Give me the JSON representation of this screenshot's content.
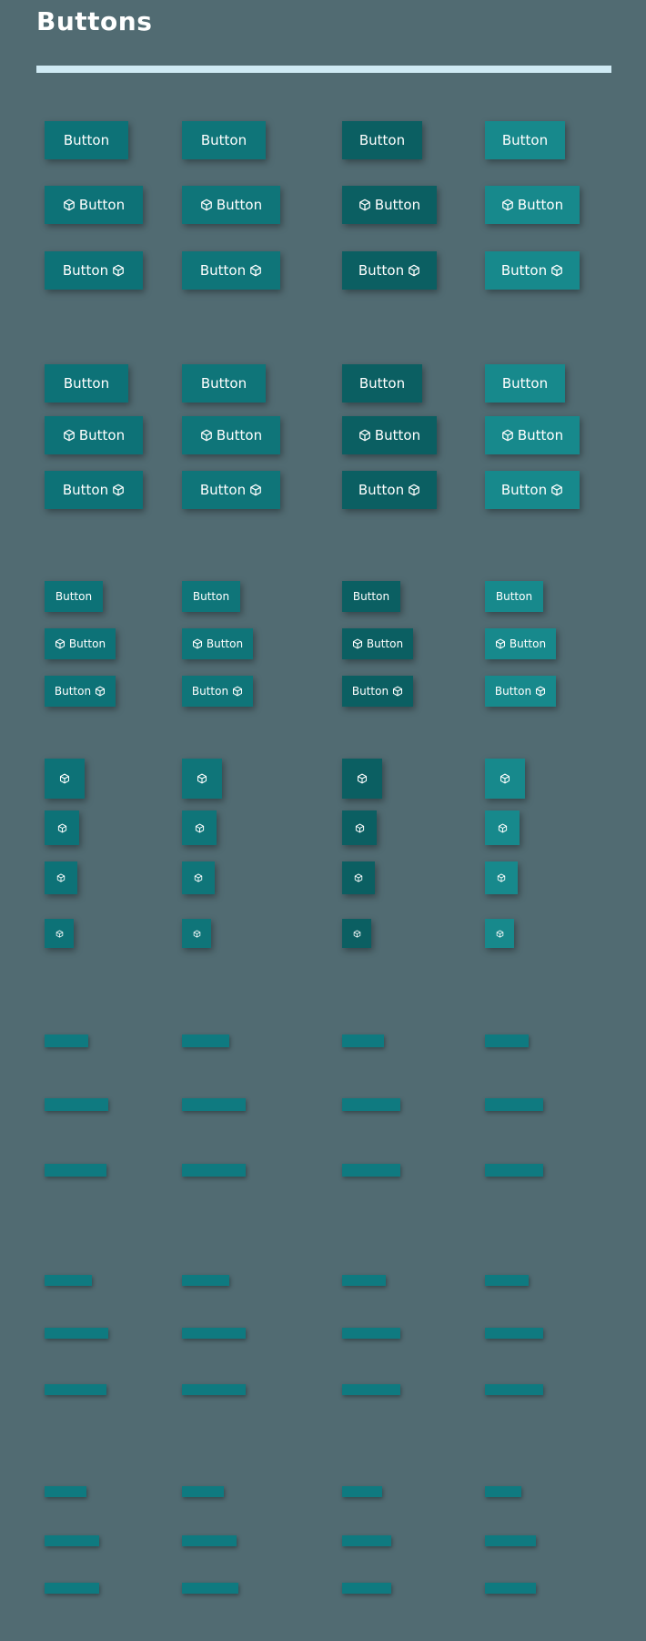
{
  "page": {
    "title": "Buttons"
  },
  "colors": {
    "background": "#516b72",
    "rule": "#cfeaf4",
    "variants": [
      "#0d7277",
      "#0f7579",
      "#0b5f62",
      "#17898c"
    ],
    "ghost_text": "#0f7a80"
  },
  "icon_name": "box-icon",
  "label": "Button",
  "groups": [
    {
      "name": "large-filled",
      "size": "lg"
    },
    {
      "name": "large-filled-alt",
      "size": "lg"
    },
    {
      "name": "medium-filled",
      "size": "md"
    },
    {
      "name": "icon-only",
      "size": "icon"
    },
    {
      "name": "large-ghost",
      "size": "lg"
    },
    {
      "name": "medium-ghost",
      "size": "md"
    },
    {
      "name": "small-ghost",
      "size": "sm"
    }
  ]
}
